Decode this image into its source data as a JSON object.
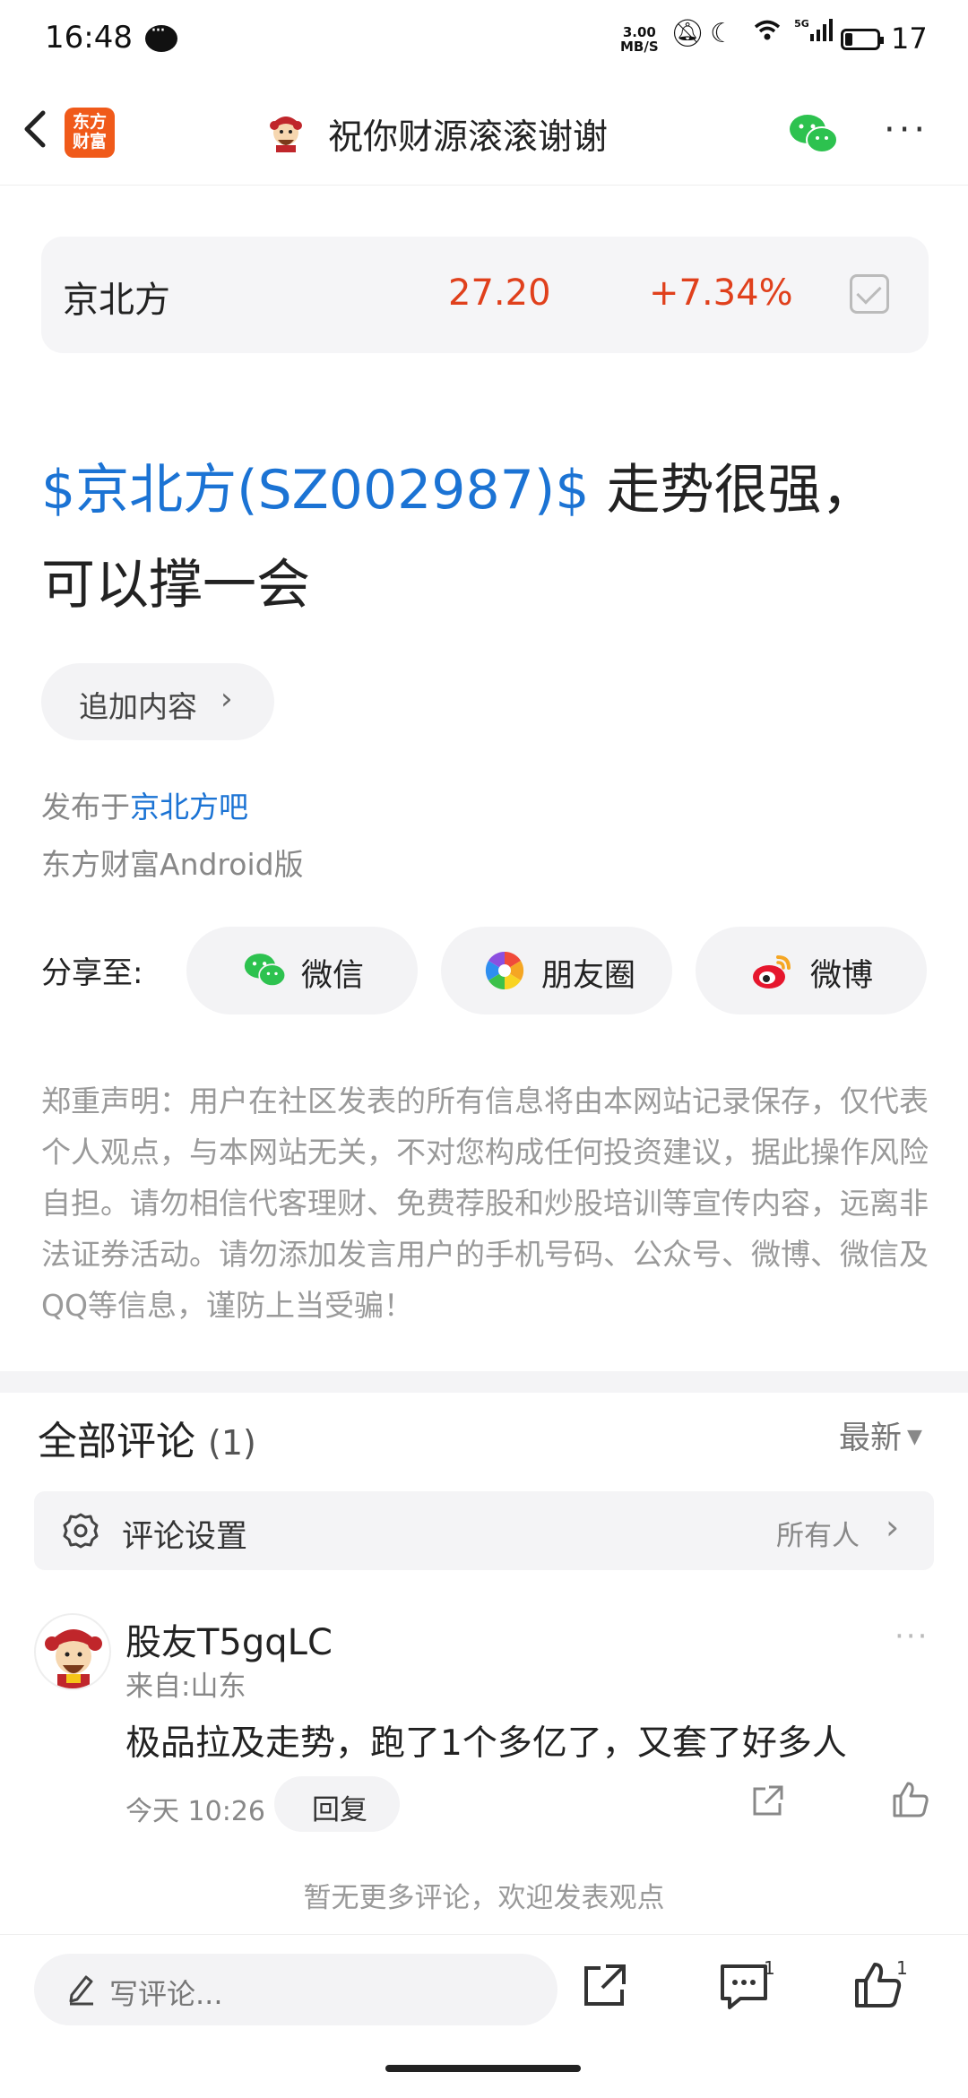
{
  "status": {
    "time": "16:48",
    "speed_top": "3.00",
    "speed_bottom": "MB/S",
    "signal": "5G",
    "battery": "17"
  },
  "nav": {
    "logo_line1": "东方",
    "logo_line2": "财富",
    "title": "祝你财源滚滚谢谢"
  },
  "stock": {
    "name": "京北方",
    "price": "27.20",
    "change": "+7.34%"
  },
  "post": {
    "tag": "$京北方(SZ002987)$",
    "body": " 走势很强，可以撑一会"
  },
  "add_content": {
    "label": "追加内容",
    "chevron": "›"
  },
  "publish": {
    "prefix": "发布于",
    "forum": "京北方吧",
    "client": "东方财富Android版"
  },
  "share": {
    "label": "分享至:",
    "targets": [
      {
        "label": "微信",
        "icon": "wechat-icon"
      },
      {
        "label": "朋友圈",
        "icon": "moments-icon"
      },
      {
        "label": "微博",
        "icon": "weibo-icon"
      }
    ]
  },
  "disclaimer": "郑重声明：用户在社区发表的所有信息将由本网站记录保存，仅代表个人观点，与本网站无关，不对您构成任何投资建议，据此操作风险自担。请勿相信代客理财、免费荐股和炒股培训等宣传内容，远离非法证券活动。请勿添加发言用户的手机号码、公众号、微博、微信及QQ等信息，谨防上当受骗！",
  "comments": {
    "title": "全部评论",
    "count": "(1)",
    "sort": "最新",
    "settings_label": "评论设置",
    "settings_value": "所有人",
    "items": [
      {
        "user": "股友T5gqLC",
        "from": "来自:山东",
        "text": "极品拉及走势，跑了1个多亿了，又套了好多人",
        "time": "今天 10:26",
        "reply": "回复"
      }
    ],
    "no_more": "暂无更多评论，欢迎发表观点"
  },
  "bottom": {
    "placeholder": "写评论...",
    "comment_count": "1",
    "like_count": "1"
  },
  "colors": {
    "accent_blue": "#1b73d4",
    "up_red": "#e0401c",
    "brand_orange": "#f05a1a"
  }
}
